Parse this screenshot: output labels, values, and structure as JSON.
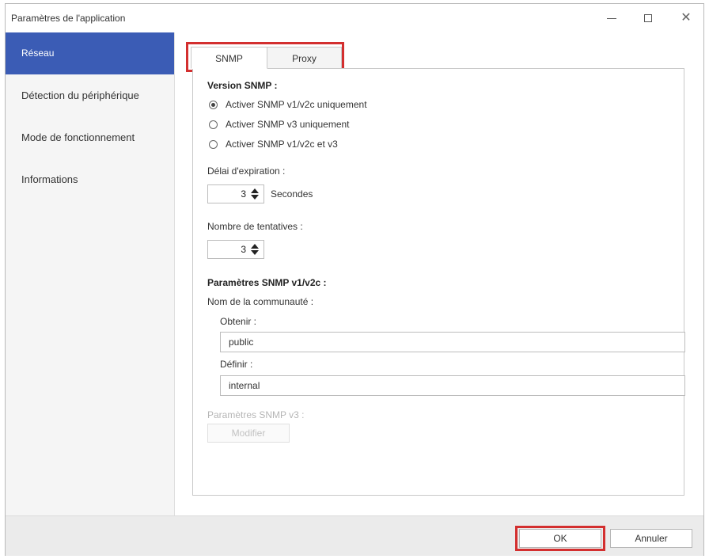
{
  "window": {
    "title": "Paramètres de l'application"
  },
  "sidebar": {
    "items": [
      {
        "label": "Réseau",
        "active": true
      },
      {
        "label": "Détection du périphérique",
        "active": false
      },
      {
        "label": "Mode de fonctionnement",
        "active": false
      },
      {
        "label": "Informations",
        "active": false
      }
    ]
  },
  "tabs": [
    {
      "label": "SNMP",
      "selected": true
    },
    {
      "label": "Proxy",
      "selected": false
    }
  ],
  "snmp": {
    "version_label": "Version SNMP :",
    "options": [
      {
        "label": "Activer SNMP v1/v2c uniquement",
        "checked": true
      },
      {
        "label": "Activer SNMP v3 uniquement",
        "checked": false
      },
      {
        "label": "Activer SNMP v1/v2c et v3",
        "checked": false
      }
    ],
    "timeout_label": "Délai d'expiration :",
    "timeout_value": "3",
    "timeout_unit": "Secondes",
    "retries_label": "Nombre de tentatives :",
    "retries_value": "3",
    "v1v2c_section": "Paramètres SNMP v1/v2c :",
    "community_label": "Nom de la communauté :",
    "get_label": "Obtenir :",
    "get_value": "public",
    "set_label": "Définir :",
    "set_value": "internal",
    "v3_section": "Paramètres SNMP v3 :",
    "modify_button": "Modifier"
  },
  "footer": {
    "ok": "OK",
    "cancel": "Annuler"
  },
  "colors": {
    "accent": "#3b5cb5",
    "highlight": "#d32f2f"
  },
  "icons": {
    "minimize": "minimize-icon",
    "maximize": "maximize-icon",
    "close": "close-icon",
    "spinner": "spinner-arrows-icon"
  }
}
